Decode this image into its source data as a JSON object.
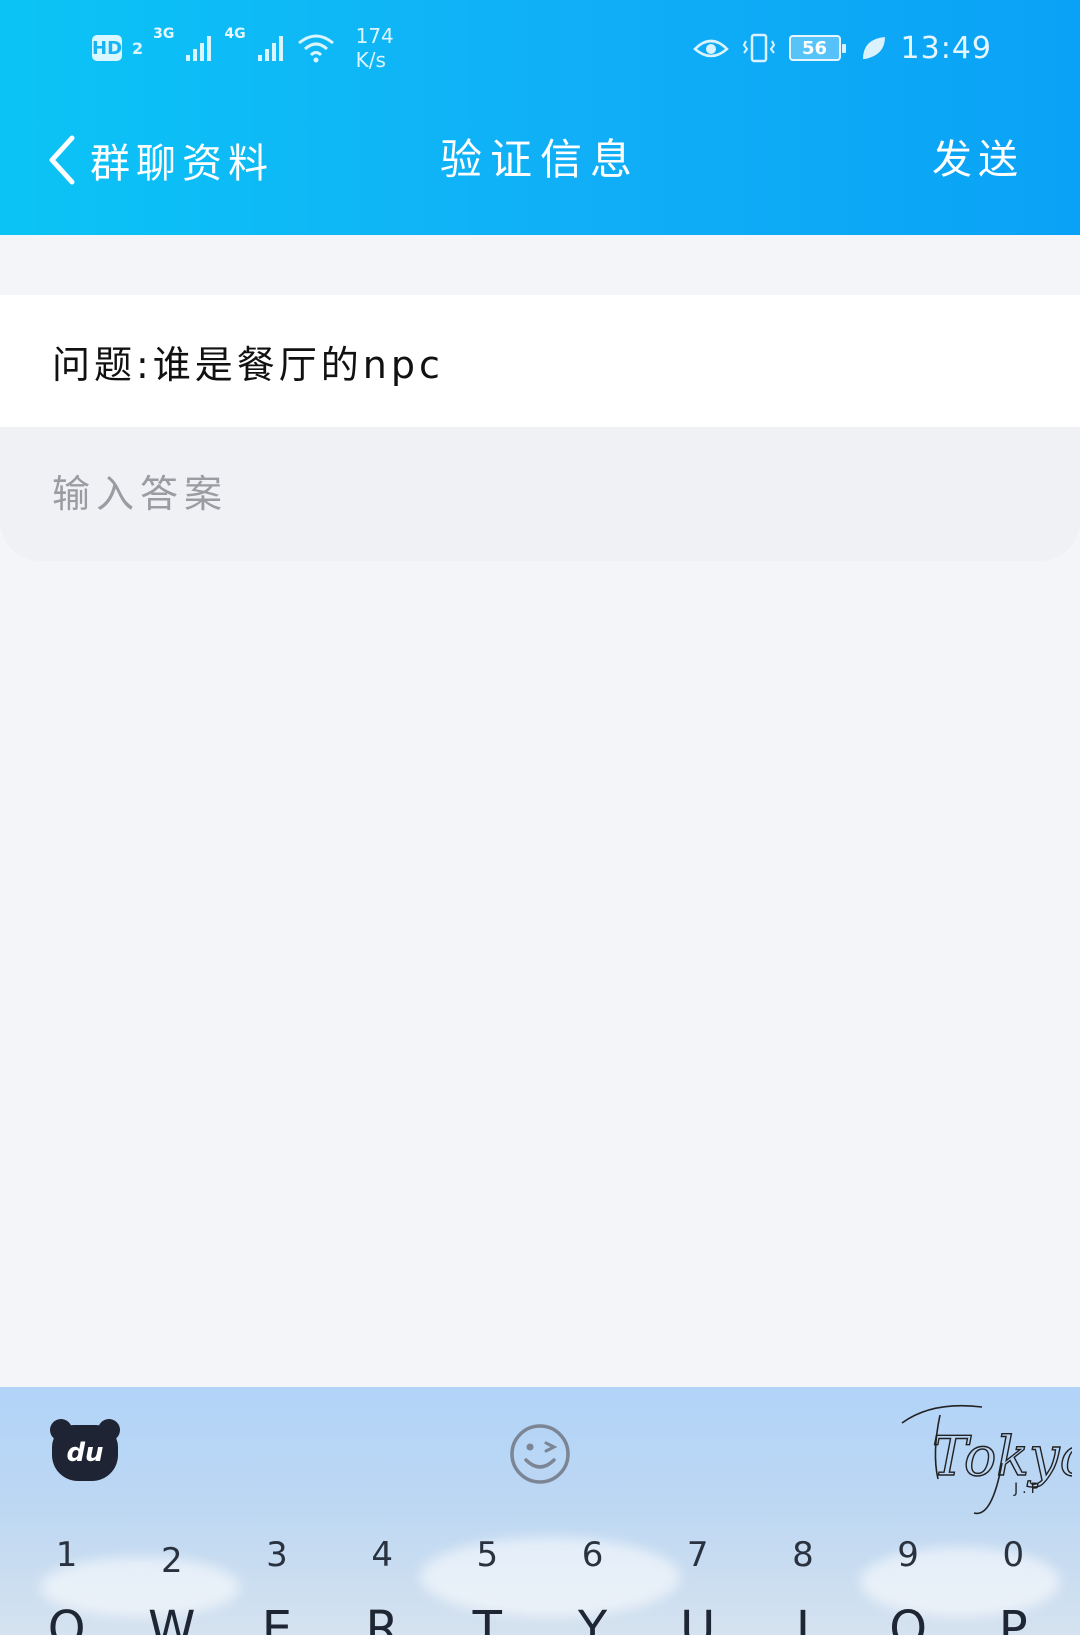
{
  "status_bar": {
    "hd_badge": "HD",
    "sim_number": "2",
    "network_3g": "3G",
    "network_4g": "4G",
    "speed_value": "174",
    "speed_unit": "K/s",
    "battery": "56",
    "time": "13:49",
    "icons": [
      "eye-icon",
      "vibrate-icon",
      "leaf-icon",
      "wifi-icon",
      "signal-icon"
    ]
  },
  "nav": {
    "back_label": "群聊资料",
    "title": "验证信息",
    "send_label": "发送"
  },
  "question": {
    "text": "问题:谁是餐厅的npc"
  },
  "answer": {
    "value": "",
    "placeholder": "输入答案"
  },
  "keyboard": {
    "logo_text": "du",
    "brand_text": "Tokyo",
    "brand_sub": "J.P",
    "number_keys": [
      "1",
      "2",
      "3",
      "4",
      "5",
      "6",
      "7",
      "8",
      "9",
      "0"
    ],
    "letter_keys": [
      "Q",
      "W",
      "E",
      "R",
      "T",
      "Y",
      "U",
      "I",
      "O",
      "P"
    ]
  },
  "colors": {
    "header_start": "#0bc4f5",
    "header_end": "#0aa2f6",
    "page_bg": "#f4f5f9",
    "placeholder": "#9a9ca1"
  }
}
